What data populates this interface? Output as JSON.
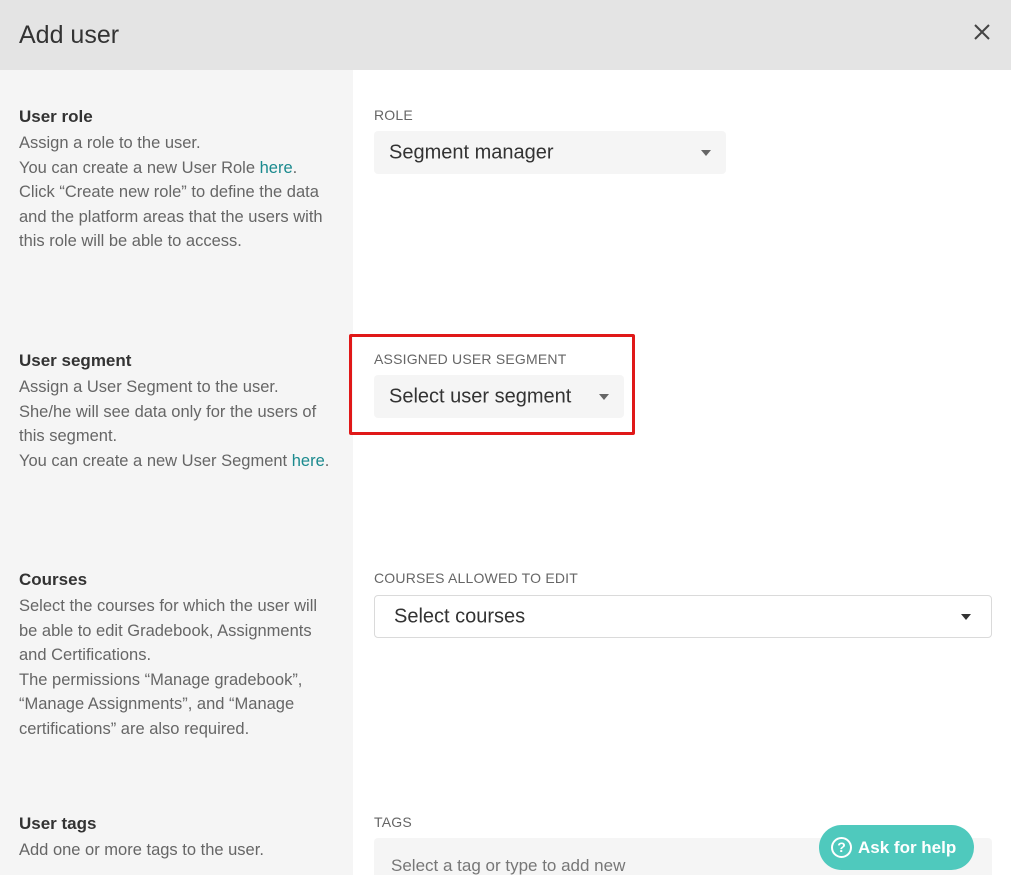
{
  "dialog": {
    "title": "Add user"
  },
  "sections": {
    "role": {
      "title": "User role",
      "desc_1": "Assign a role to the user.",
      "desc_2_pre": "You can create a new User Role ",
      "desc_2_link": "here",
      "desc_2_post": ".",
      "desc_3": "Click “Create new role” to define the data and the platform areas that the users with this role will be able to access.",
      "field_label": "ROLE",
      "field_value": "Segment manager"
    },
    "segment": {
      "title": "User segment",
      "desc_1": "Assign a User Segment to the user.",
      "desc_2": "She/he will see data only for the users of this segment.",
      "desc_3_pre": "You can create a new User Segment ",
      "desc_3_link": "here",
      "desc_3_post": ".",
      "field_label": "ASSIGNED USER SEGMENT",
      "field_value": "Select user segment"
    },
    "courses": {
      "title": "Courses",
      "desc_1": "Select the courses for which the user will be able to edit Gradebook, Assignments and Certifications.",
      "desc_2": "The permissions “Manage gradebook”, “Manage Assignments”, and “Manage certifications” are also required.",
      "field_label": "COURSES ALLOWED TO EDIT",
      "field_value": "Select courses"
    },
    "tags": {
      "title": "User tags",
      "desc_1": "Add one or more tags to the user.",
      "field_label": "TAGS",
      "placeholder": "Select a tag or type to add new"
    }
  },
  "help": {
    "icon": "?",
    "label": "Ask for help"
  },
  "colors": {
    "header_bg": "#e4e4e4",
    "left_panel_bg": "#f5f5f5",
    "link": "#1b8a8e",
    "highlight_border": "#e01818",
    "help_button": "#4fc9bd"
  }
}
